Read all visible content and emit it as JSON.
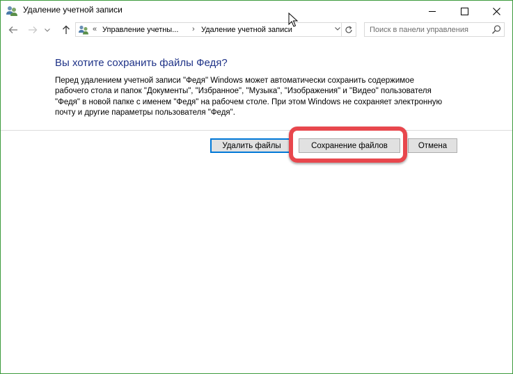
{
  "window": {
    "title": "Удаление учетной записи",
    "minimize_icon": "minimize-icon",
    "maximize_icon": "maximize-icon",
    "close_icon": "close-icon"
  },
  "nav": {
    "back_icon": "back-arrow-icon",
    "forward_icon": "forward-arrow-icon",
    "recent_icon": "chevron-down-icon",
    "up_icon": "up-arrow-icon"
  },
  "address": {
    "overflow": "«",
    "crumbs": [
      "Управление учетны...",
      "Удаление учетной записи"
    ],
    "separator": "›"
  },
  "search": {
    "placeholder": "Поиск в панели управления"
  },
  "content": {
    "heading": "Вы хотите сохранить файлы Федя?",
    "body_lines": [
      "Перед удалением учетной записи \"Федя\" Windows может автоматически сохранить содержимое",
      "рабочего стола и папок \"Документы\", \"Избранное\", \"Музыка\", \"Изображения\" и \"Видео\" пользователя",
      "\"Федя\" в новой папке с именем \"Федя\" на рабочем столе. При этом Windows не сохраняет электронную",
      "почту и другие параметры пользователя \"Федя\"."
    ]
  },
  "buttons": {
    "delete_files": "Удалить файлы",
    "keep_files": "Сохранение файлов",
    "cancel": "Отмена"
  },
  "colors": {
    "heading": "#1e3287",
    "window_border": "#3c9a3c",
    "highlight": "#e8474d",
    "default_button_border": "#0078d7"
  }
}
